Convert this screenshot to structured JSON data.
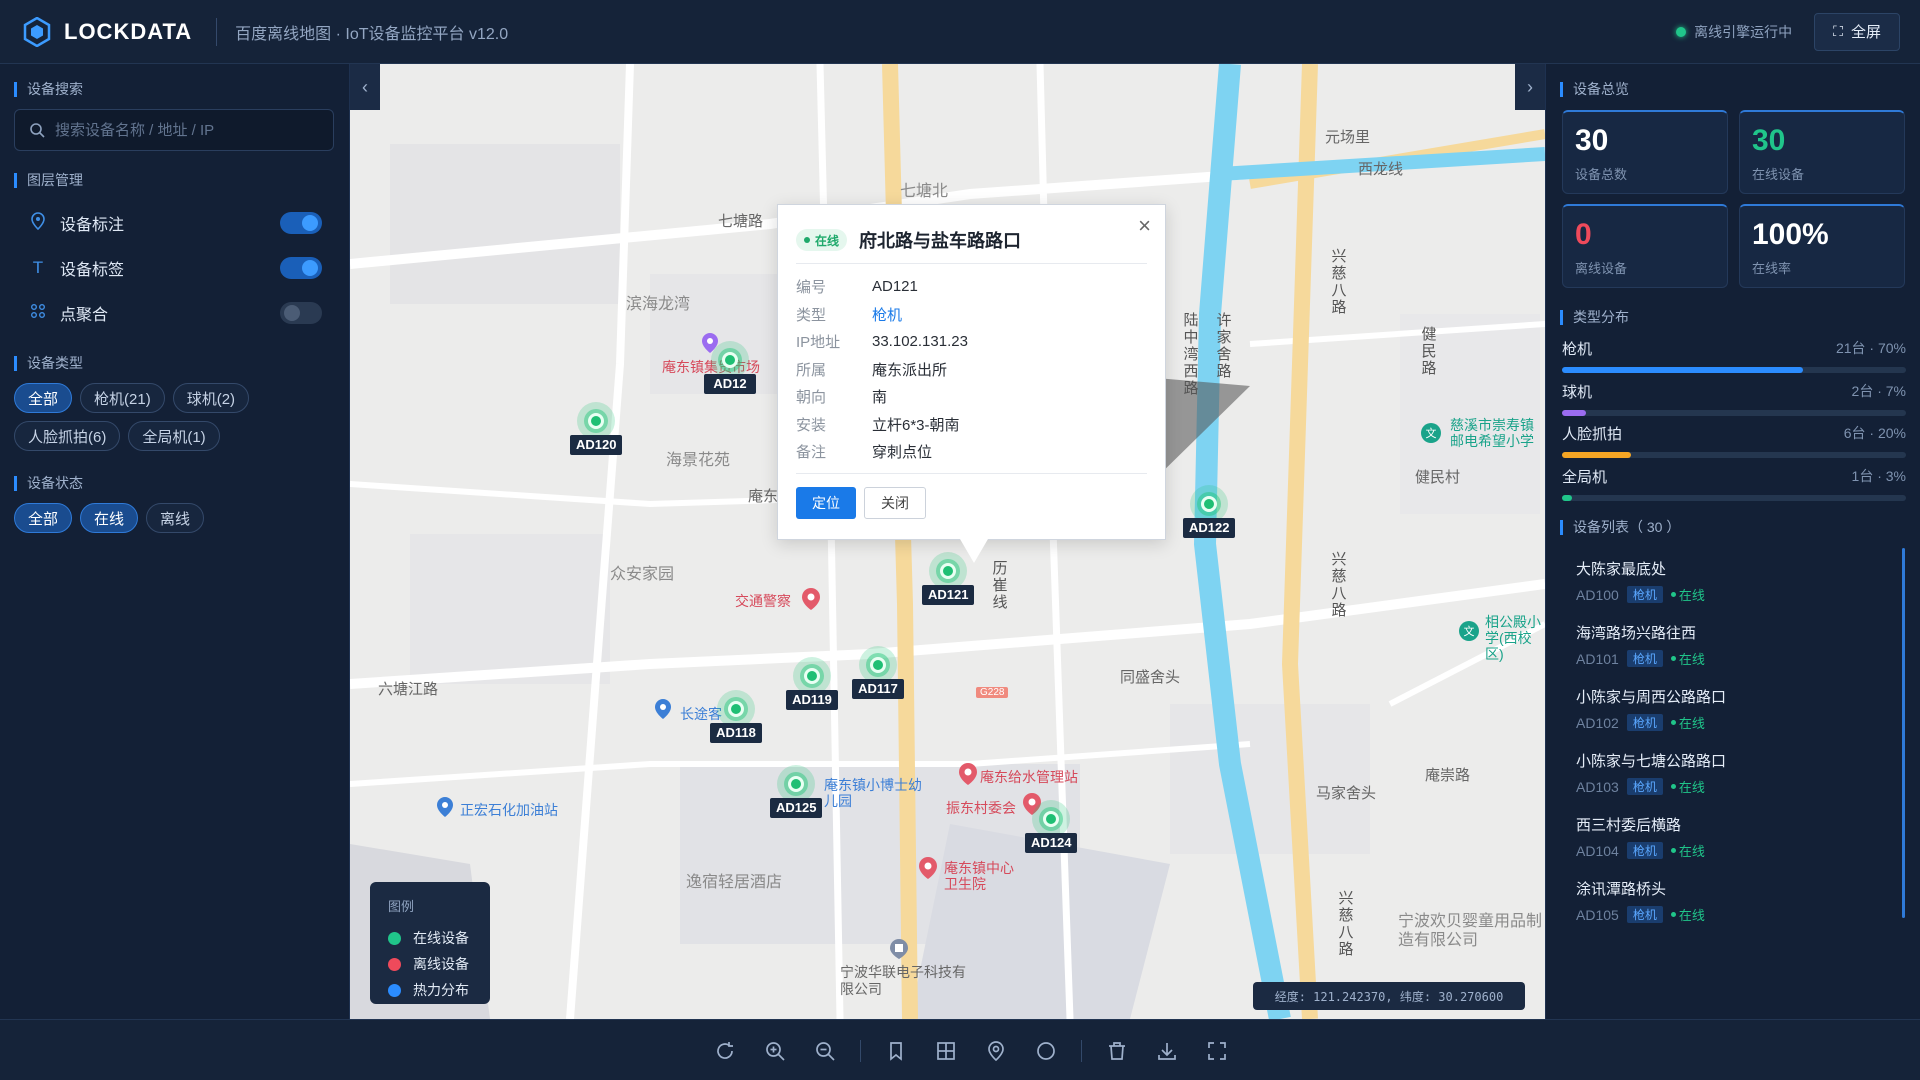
{
  "header": {
    "brand": "LOCKDATA",
    "subtitle": "百度离线地图 · IoT设备监控平台 v12.0",
    "engine_status": "离线引擎运行中",
    "fullscreen_label": "全屏"
  },
  "left": {
    "search_title": "设备搜索",
    "search_placeholder": "搜索设备名称 / 地址 / IP",
    "layers_title": "图层管理",
    "layers": [
      {
        "label": "设备标注",
        "on": true
      },
      {
        "label": "设备标签",
        "on": true
      },
      {
        "label": "点聚合",
        "on": false
      }
    ],
    "type_title": "设备类型",
    "types": [
      "全部",
      "枪机(21)",
      "球机(2)",
      "人脸抓拍(6)",
      "全局机(1)"
    ],
    "status_title": "设备状态",
    "statuses": [
      "全部",
      "在线",
      "离线"
    ]
  },
  "map": {
    "labels": {
      "qitangbei": "七塘北",
      "qitanglu": "七塘路",
      "binhai": "滨海龙湾",
      "haijing": "海景花苑",
      "zhongan": "众安家园",
      "liutang": "六塘江路",
      "tongsheng": "同盛舍头",
      "majia": "马家舍头",
      "yanchong": "庵崇路",
      "yuanchang": "元场里",
      "xilong": "西龙线",
      "jianmin": "健民村",
      "yisu": "逸宿轻居酒店",
      "ningbo_huanbei": "宁波欢贝婴童用品制造有限公司",
      "market": "庵东镇集贸市场",
      "traffic": "交通警察",
      "changtu": "长途客",
      "zhenghong": "正宏石化加油站",
      "kindergarten": "庵东镇小博士幼儿园",
      "water": "庵东给水管理站",
      "village": "振东村委会",
      "health": "庵东镇中心卫生院",
      "huanlian": "宁波华联电子科技有限公司",
      "school": "慈溪市崇寿镇邮电希望小学",
      "xianggong": "相公殿小学(西校区)",
      "andong": "庵东",
      "g228": "G228",
      "lichongxian": "历崔线",
      "xinghui": "兴慈八路",
      "luzhong": "陆中湾西路",
      "xujia": "许家舍路",
      "jianmin_road": "健民路"
    },
    "markers": [
      {
        "code": "AD120"
      },
      {
        "code": "AD12"
      },
      {
        "code": "AD121"
      },
      {
        "code": "AD122"
      },
      {
        "code": "AD119"
      },
      {
        "code": "AD117"
      },
      {
        "code": "AD118"
      },
      {
        "code": "AD125"
      },
      {
        "code": "AD124"
      }
    ],
    "popup": {
      "status": "在线",
      "title": "府北路与盐车路路口",
      "rows": [
        {
          "k": "编号",
          "v": "AD121"
        },
        {
          "k": "类型",
          "v": "枪机"
        },
        {
          "k": "IP地址",
          "v": "33.102.131.23"
        },
        {
          "k": "所属",
          "v": "庵东派出所"
        },
        {
          "k": "朝向",
          "v": "南"
        },
        {
          "k": "安装",
          "v": "立杆6*3-朝南"
        },
        {
          "k": "备注",
          "v": "穿刺点位"
        }
      ],
      "locate_label": "定位",
      "close_label": "关闭"
    },
    "legend": {
      "title": "图例",
      "items": [
        {
          "label": "在线设备",
          "color": "#20c58a"
        },
        {
          "label": "离线设备",
          "color": "#ef4a5b"
        },
        {
          "label": "热力分布",
          "color": "#2b8cff"
        }
      ]
    },
    "coords": "经度: 121.242370, 纬度: 30.270600"
  },
  "right": {
    "overview_title": "设备总览",
    "stats": [
      {
        "num": "30",
        "label": "设备总数"
      },
      {
        "num": "30",
        "label": "在线设备"
      },
      {
        "num": "0",
        "label": "离线设备"
      },
      {
        "num": "100%",
        "label": "在线率"
      }
    ],
    "dist_title": "类型分布",
    "dist": [
      {
        "name": "枪机",
        "val": "21台 · 70%",
        "pct": 70,
        "color": "#2b8cff"
      },
      {
        "name": "球机",
        "val": "2台 · 7%",
        "pct": 7,
        "color": "#9b6cf0"
      },
      {
        "name": "人脸抓拍",
        "val": "6台 · 20%",
        "pct": 20,
        "color": "#f5a524"
      },
      {
        "name": "全局机",
        "val": "1台 · 3%",
        "pct": 3,
        "color": "#20c58a"
      }
    ],
    "list_title": "设备列表（ 30 ）",
    "devices": [
      {
        "name": "大陈家最底处",
        "code": "AD100",
        "type": "枪机",
        "status": "在线"
      },
      {
        "name": "海湾路场兴路往西",
        "code": "AD101",
        "type": "枪机",
        "status": "在线"
      },
      {
        "name": "小陈家与周西公路路口",
        "code": "AD102",
        "type": "枪机",
        "status": "在线"
      },
      {
        "name": "小陈家与七塘公路路口",
        "code": "AD103",
        "type": "枪机",
        "status": "在线"
      },
      {
        "name": "西三村委后横路",
        "code": "AD104",
        "type": "枪机",
        "status": "在线"
      },
      {
        "name": "涂讯潭路桥头",
        "code": "AD105",
        "type": "枪机",
        "status": "在线"
      }
    ]
  }
}
